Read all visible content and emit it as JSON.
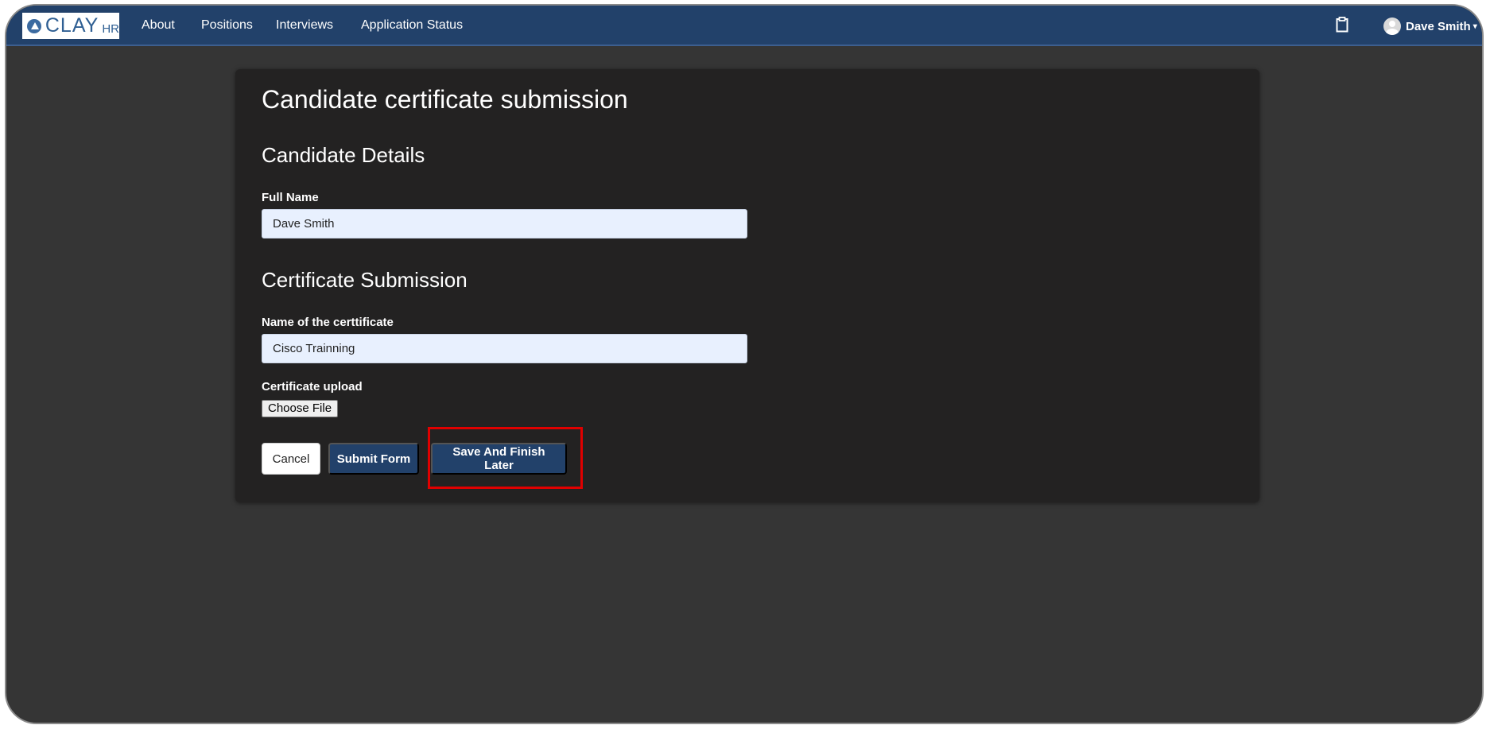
{
  "navbar": {
    "logo_text": "CLAY",
    "logo_sub": "HR",
    "links": [
      "About",
      "Positions",
      "Interviews",
      "Application Status"
    ],
    "user_name": "Dave Smith",
    "accent": "#22416a"
  },
  "form": {
    "title": "Candidate certificate submission",
    "candidate_section": "Candidate Details",
    "full_name_label": "Full Name",
    "full_name_value": "Dave Smith",
    "certificate_section": "Certificate Submission",
    "cert_name_label": "Name of the certtificate",
    "cert_name_value": "Cisco Trainning",
    "upload_label": "Certificate upload",
    "choose_file": "Choose File",
    "cancel": "Cancel",
    "submit": "Submit Form",
    "save_later": "Save And Finish Later"
  },
  "highlight_color": "#e00000"
}
